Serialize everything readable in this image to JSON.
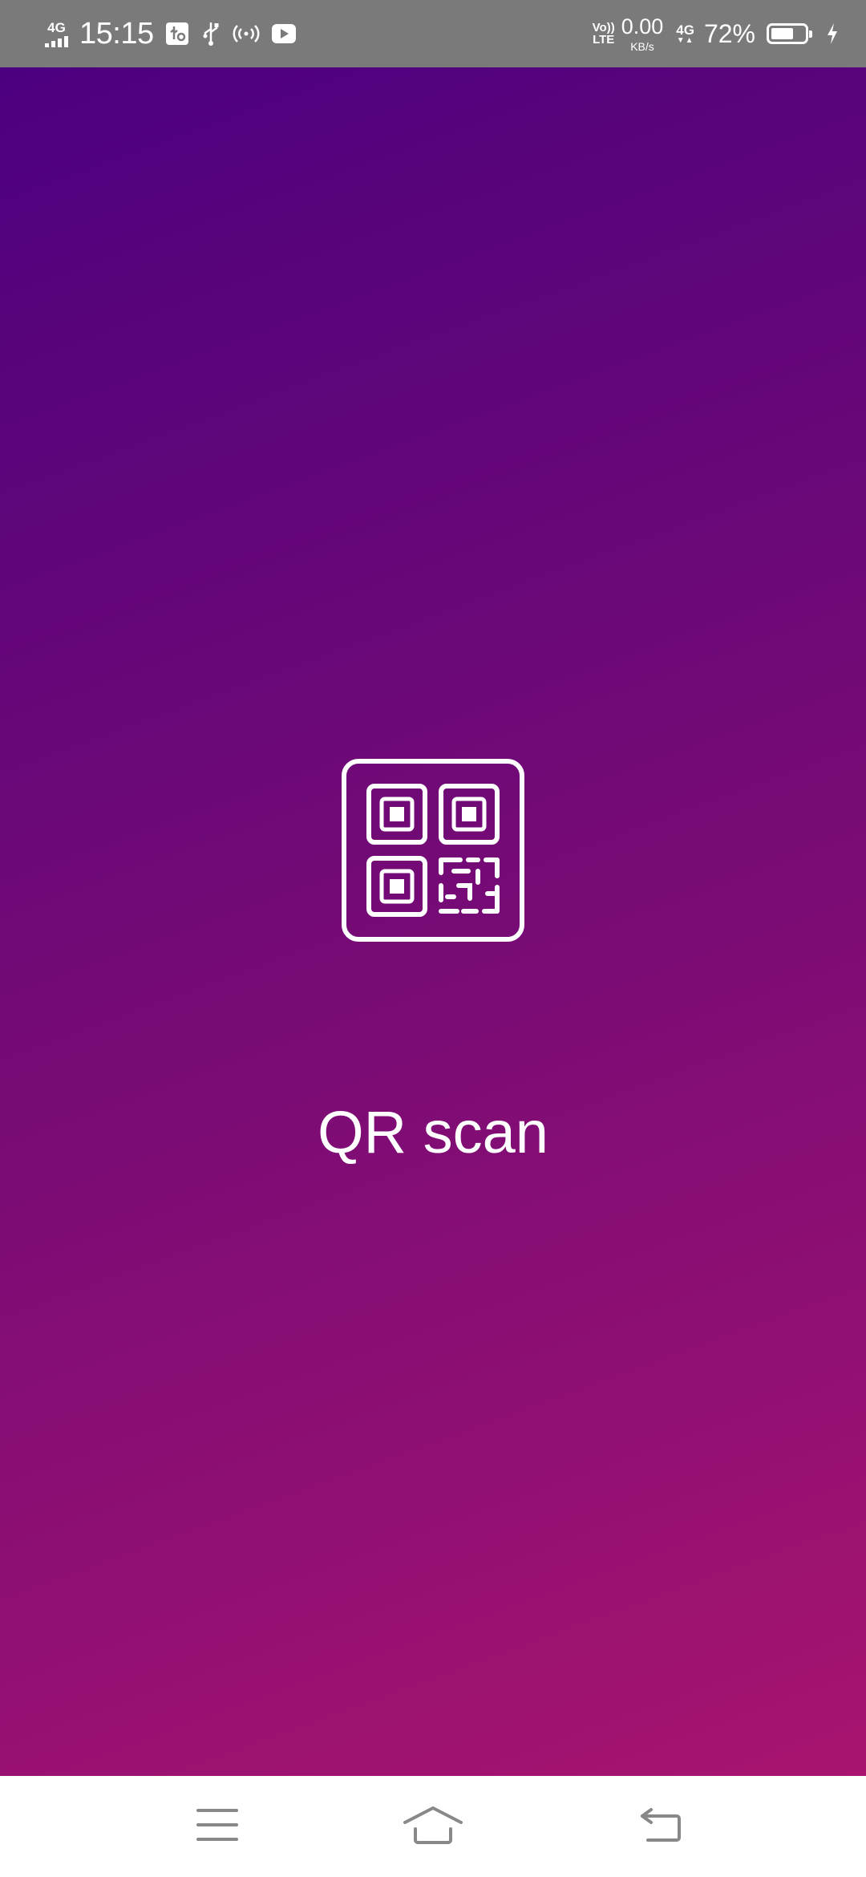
{
  "status_bar": {
    "network_left": "4G",
    "time": "15:15",
    "volte_top": "Vo))",
    "volte_bottom": "LTE",
    "speed_value": "0.00",
    "speed_unit": "KB/s",
    "network_right": "4G",
    "battery_percent": "72%",
    "battery_level": 0.72,
    "icons": [
      "usb-debug-icon",
      "usb-icon",
      "hotspot-icon",
      "youtube-icon",
      "charging-icon"
    ]
  },
  "splash": {
    "title": "QR scan",
    "icon": "qr-code-icon",
    "colors": {
      "gradient_start": "#4c007f",
      "gradient_end": "#a8146f",
      "foreground": "#ffffff"
    }
  },
  "nav_bar": {
    "buttons": [
      "menu-icon",
      "home-icon",
      "back-icon"
    ],
    "icon_color": "#888888"
  }
}
